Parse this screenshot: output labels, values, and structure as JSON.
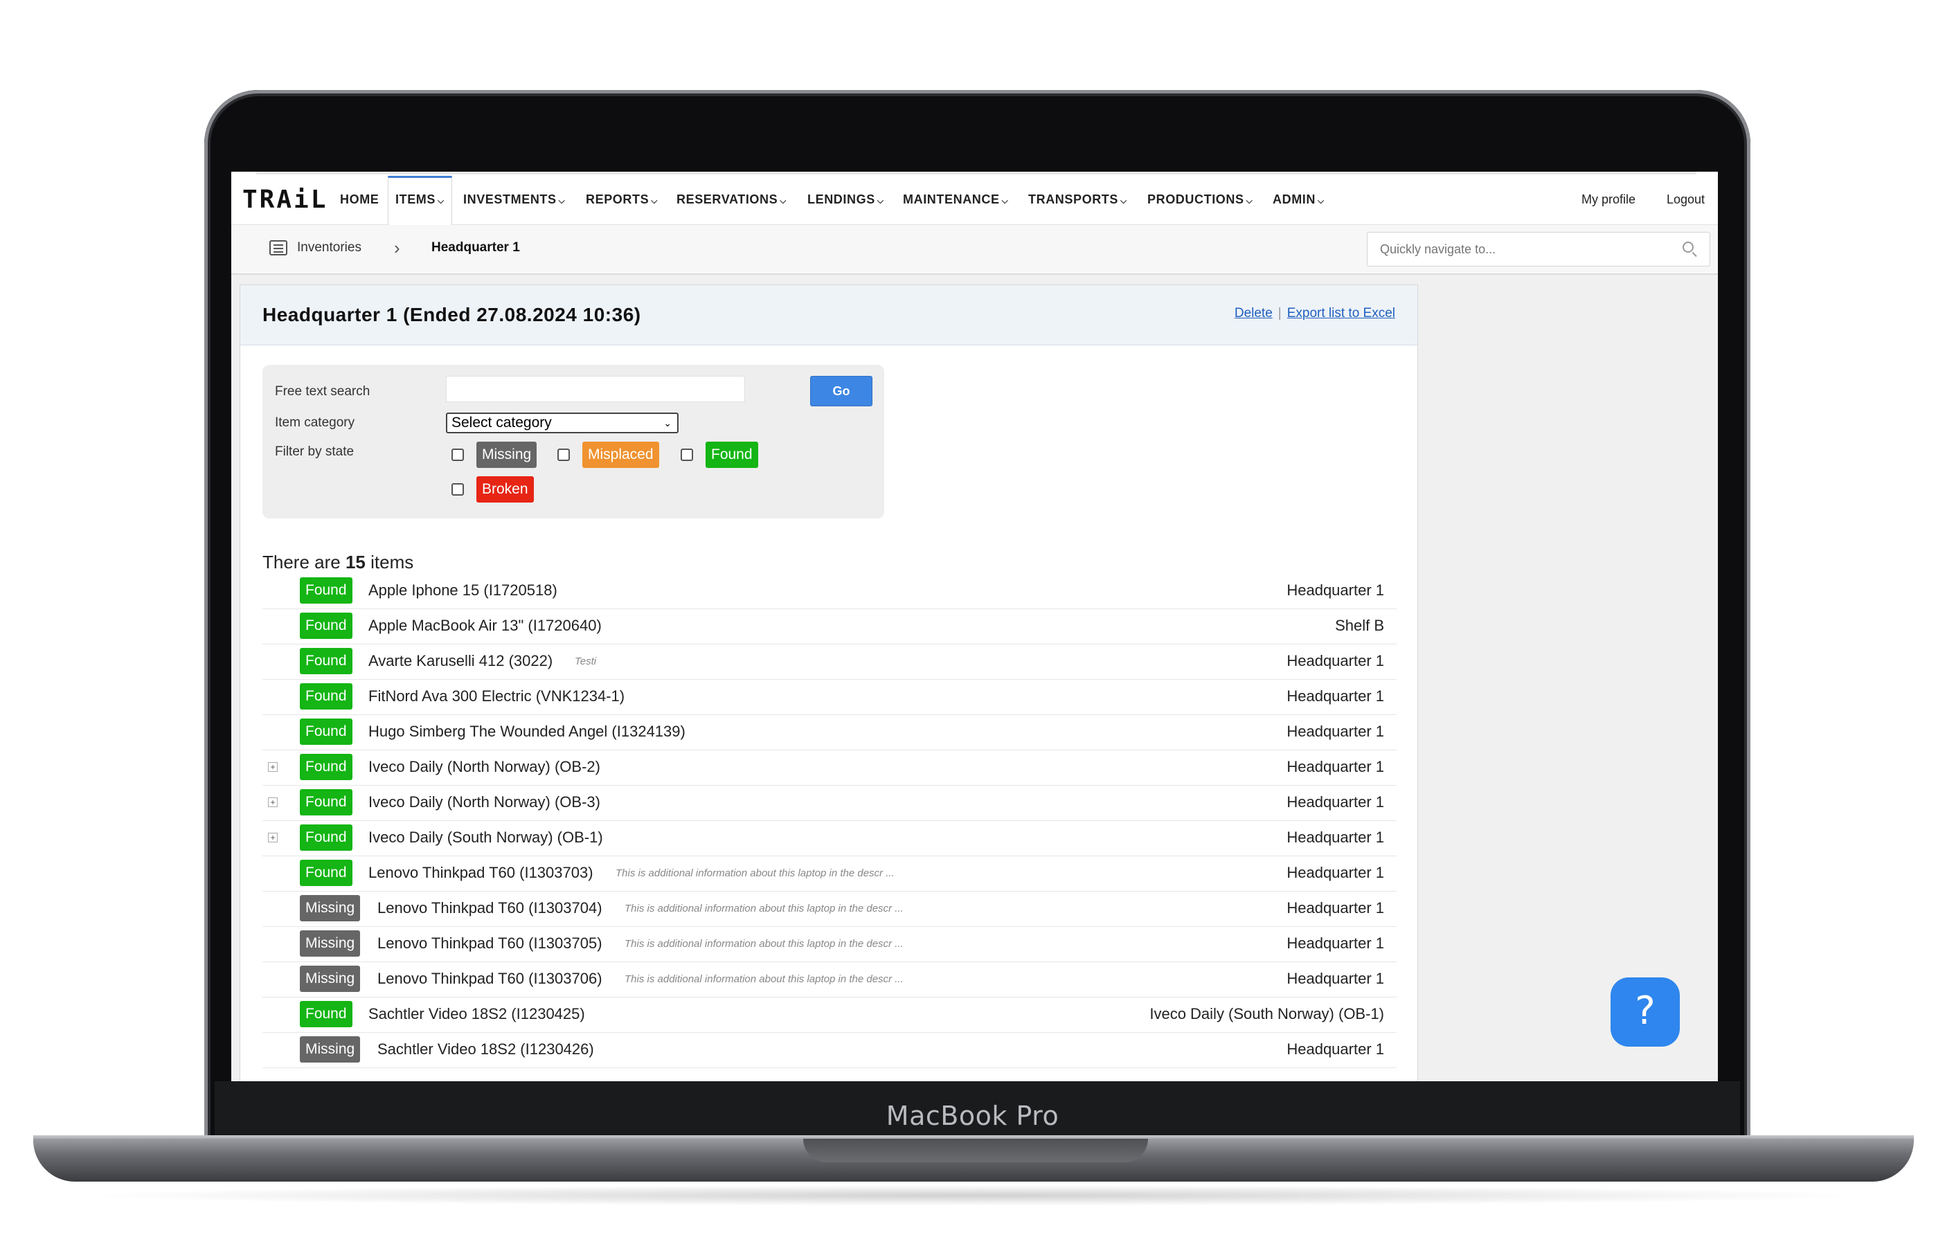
{
  "device_label": "MacBook Pro",
  "app": {
    "logo": "TRAiL",
    "nav": [
      {
        "label": "HOME",
        "dropdown": false
      },
      {
        "label": "ITEMS",
        "dropdown": true,
        "active": true
      },
      {
        "label": "INVESTMENTS",
        "dropdown": true
      },
      {
        "label": "REPORTS",
        "dropdown": true
      },
      {
        "label": "RESERVATIONS",
        "dropdown": true
      },
      {
        "label": "LENDINGS",
        "dropdown": true
      },
      {
        "label": "MAINTENANCE",
        "dropdown": true
      },
      {
        "label": "TRANSPORTS",
        "dropdown": true
      },
      {
        "label": "PRODUCTIONS",
        "dropdown": true
      },
      {
        "label": "ADMIN",
        "dropdown": true
      }
    ],
    "my_profile": "My profile",
    "logout": "Logout"
  },
  "breadcrumb": {
    "parent": "Inventories",
    "current": "Headquarter 1",
    "quick_nav_placeholder": "Quickly navigate to..."
  },
  "panel": {
    "title": "Headquarter 1 (Ended 27.08.2024 10:36)",
    "delete_link": "Delete",
    "export_link": "Export list to Excel"
  },
  "filters": {
    "free_text_label": "Free text search",
    "free_text_value": "",
    "go_label": "Go",
    "category_label": "Item category",
    "category_value": "Select category",
    "state_label": "Filter by state",
    "states": {
      "missing": "Missing",
      "misplaced": "Misplaced",
      "found": "Found",
      "broken": "Broken"
    }
  },
  "summary": {
    "prefix": "There are",
    "count": "15",
    "suffix": "items"
  },
  "colors": {
    "found": "#14b514",
    "missing": "#666666",
    "misplaced": "#f0922f",
    "broken": "#e62514",
    "accent": "#3d86e3"
  },
  "items": [
    {
      "state": "Found",
      "name": "Apple Iphone 15 (I1720518)",
      "note": "",
      "location": "Headquarter 1",
      "expandable": false
    },
    {
      "state": "Found",
      "name": "Apple MacBook Air 13\" (I1720640)",
      "note": "",
      "location": "Shelf B",
      "expandable": false
    },
    {
      "state": "Found",
      "name": "Avarte Karuselli 412 (3022)",
      "note": "Testi",
      "location": "Headquarter 1",
      "expandable": false
    },
    {
      "state": "Found",
      "name": "FitNord Ava 300 Electric (VNK1234-1)",
      "note": "",
      "location": "Headquarter 1",
      "expandable": false
    },
    {
      "state": "Found",
      "name": "Hugo Simberg The Wounded Angel (I1324139)",
      "note": "",
      "location": "Headquarter 1",
      "expandable": false
    },
    {
      "state": "Found",
      "name": "Iveco Daily (North Norway) (OB-2)",
      "note": "",
      "location": "Headquarter 1",
      "expandable": true
    },
    {
      "state": "Found",
      "name": "Iveco Daily (North Norway) (OB-3)",
      "note": "",
      "location": "Headquarter 1",
      "expandable": true
    },
    {
      "state": "Found",
      "name": "Iveco Daily (South Norway) (OB-1)",
      "note": "",
      "location": "Headquarter 1",
      "expandable": true
    },
    {
      "state": "Found",
      "name": "Lenovo Thinkpad T60 (I1303703)",
      "note": "This is additional information about this laptop in the descr ...",
      "location": "Headquarter 1",
      "expandable": false
    },
    {
      "state": "Missing",
      "name": "Lenovo Thinkpad T60 (I1303704)",
      "note": "This is additional information about this laptop in the descr ...",
      "location": "Headquarter 1",
      "expandable": false
    },
    {
      "state": "Missing",
      "name": "Lenovo Thinkpad T60 (I1303705)",
      "note": "This is additional information about this laptop in the descr ...",
      "location": "Headquarter 1",
      "expandable": false
    },
    {
      "state": "Missing",
      "name": "Lenovo Thinkpad T60 (I1303706)",
      "note": "This is additional information about this laptop in the descr ...",
      "location": "Headquarter 1",
      "expandable": false
    },
    {
      "state": "Found",
      "name": "Sachtler Video 18S2 (I1230425)",
      "note": "",
      "location": "Iveco Daily (South Norway) (OB-1)",
      "expandable": false
    },
    {
      "state": "Missing",
      "name": "Sachtler Video 18S2 (I1230426)",
      "note": "",
      "location": "Headquarter 1",
      "expandable": false
    }
  ],
  "help_button": "?"
}
